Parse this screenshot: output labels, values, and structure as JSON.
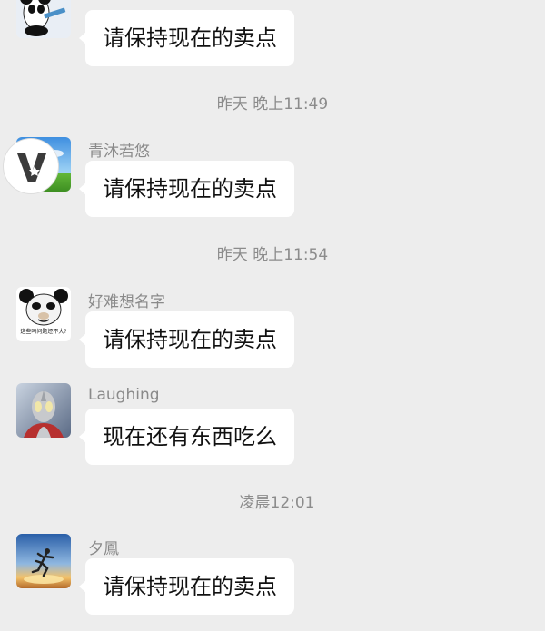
{
  "messages": [
    {
      "sender": "",
      "text": "请保持现在的卖点",
      "avatar": "panda-avatar-icon"
    },
    {
      "sender": "青沐若悠",
      "text": "请保持现在的卖点",
      "avatar": "sky-field-avatar-icon"
    },
    {
      "sender": "好难想名字",
      "text": "请保持现在的卖点",
      "avatar": "panda-meme-avatar-icon"
    },
    {
      "sender": "Laughing",
      "text": "现在还有东西吃么",
      "avatar": "ultraman-avatar-icon"
    },
    {
      "sender": "夕鳳",
      "text": "请保持现在的卖点",
      "avatar": "runner-sunset-avatar-icon"
    }
  ],
  "timestamps": [
    "昨天 晚上11:49",
    "昨天 晚上11:54",
    "凌晨12:01"
  ],
  "avatar_caption": "这些吗问题还不大?",
  "colors": {
    "background": "#ededed",
    "bubble": "#ffffff",
    "text": "#111111",
    "meta": "#8a8a8a"
  }
}
